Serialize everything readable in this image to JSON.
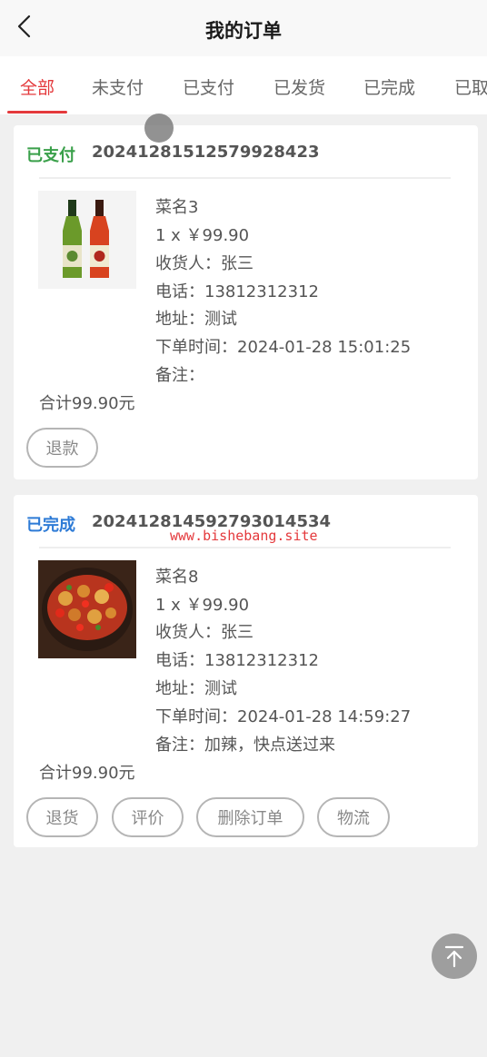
{
  "header": {
    "title": "我的订单"
  },
  "tabs": [
    {
      "label": "全部",
      "active": true
    },
    {
      "label": "未支付"
    },
    {
      "label": "已支付"
    },
    {
      "label": "已发货"
    },
    {
      "label": "已完成"
    },
    {
      "label": "已取"
    }
  ],
  "colors": {
    "accent": "#e4393c",
    "paid": "#3aa04a",
    "done": "#2e7bd6"
  },
  "orders": [
    {
      "status": "已支付",
      "order_no": "20241281512579928423",
      "image_icon": "bottled-drinks-image",
      "name": "菜名3",
      "qty_price": "1 x ￥99.90",
      "receiver": "收货人：张三",
      "phone": "电话：13812312312",
      "address": "地址：测试",
      "order_time": "下单时间：2024-01-28 15:01:25",
      "note": "备注：",
      "total": "合计99.90元",
      "buttons": [
        "退款"
      ]
    },
    {
      "status": "已完成",
      "order_no": "20241281459279301453­4",
      "image_icon": "spicy-chicken-dish-image",
      "name": "菜名8",
      "qty_price": "1 x ￥99.90",
      "receiver": "收货人：张三",
      "phone": "电话：13812312312",
      "address": "地址：测试",
      "order_time": "下单时间：2024-01-28 14:59:27",
      "note": "备注：加辣，快点送过来",
      "total": "合计99.90元",
      "buttons": [
        "退货",
        "评价",
        "删除订单",
        "物流"
      ]
    }
  ],
  "watermark": "www.bishebang.site"
}
